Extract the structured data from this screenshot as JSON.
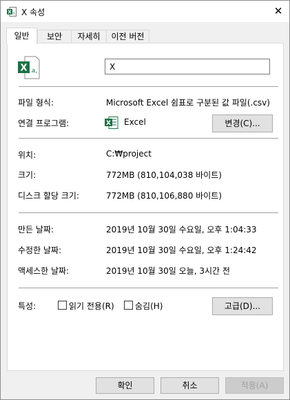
{
  "window": {
    "title": "X 속성",
    "close_glyph": "✕",
    "app_icon": "excel-csv-icon"
  },
  "tabs": [
    {
      "label": "일반",
      "active": true
    },
    {
      "label": "보안",
      "active": false
    },
    {
      "label": "자세히",
      "active": false
    },
    {
      "label": "이전 버전",
      "active": false
    }
  ],
  "general": {
    "file_name": "X",
    "file_icon": "excel-csv-icon",
    "type": {
      "label": "파일 형식:",
      "value": "Microsoft Excel 쉼표로 구분된 값 파일(.csv)"
    },
    "opens_with": {
      "label": "연결 프로그램:",
      "app_name": "Excel",
      "app_icon": "excel-icon",
      "change_button": "변경(C)..."
    },
    "location": {
      "label": "위치:",
      "value": "C:₩project"
    },
    "size": {
      "label": "크기:",
      "value": "772MB (810,104,038 바이트)"
    },
    "size_on_disk": {
      "label": "디스크 할당 크기:",
      "value": "772MB (810,106,880 바이트)"
    },
    "created": {
      "label": "만든 날짜:",
      "value": "2019년 10월 30일 수요일, 오후 1:04:33"
    },
    "modified": {
      "label": "수정한 날짜:",
      "value": "2019년 10월 30일 수요일, 오후 1:24:42"
    },
    "accessed": {
      "label": "액세스한 날짜:",
      "value": "2019년 10월 30일 오늘, 3시간 전"
    },
    "attributes": {
      "label": "특성:",
      "readonly": {
        "label": "읽기 전용(R)",
        "checked": false
      },
      "hidden": {
        "label": "숨김(H)",
        "checked": false
      },
      "advanced_button": "고급(D)..."
    }
  },
  "footer": {
    "ok": "확인",
    "cancel": "취소",
    "apply": {
      "label": "적용(A)",
      "enabled": false
    }
  },
  "colors": {
    "excel_green": "#1e7145",
    "panel_bg": "#ffffff",
    "window_bg": "#f0f0f0",
    "disabled_text": "#a0a0a0"
  }
}
